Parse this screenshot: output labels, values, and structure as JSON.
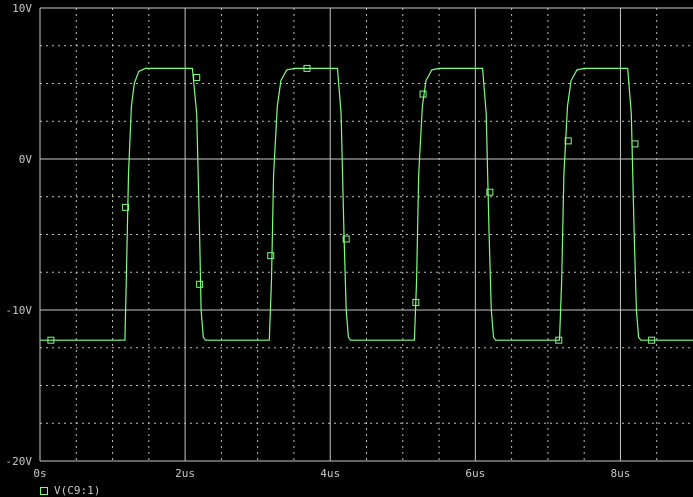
{
  "colors": {
    "background": "#000000",
    "axis": "#c8c8c8",
    "grid_major": "#c8c8c8",
    "grid_minor": "#bdbdbd",
    "trace": "#7dff7d"
  },
  "chart_data": {
    "type": "line",
    "title": "",
    "xlabel": "",
    "ylabel": "",
    "xlim": [
      0,
      9.0
    ],
    "ylim": [
      -20,
      10
    ],
    "x_unit": "us",
    "y_unit": "V",
    "x_ticks": [
      {
        "value": 0,
        "label": "0s"
      },
      {
        "value": 2,
        "label": "2us"
      },
      {
        "value": 4,
        "label": "4us"
      },
      {
        "value": 6,
        "label": "6us"
      },
      {
        "value": 8,
        "label": "8us"
      }
    ],
    "y_ticks": [
      {
        "value": 10,
        "label": "10V"
      },
      {
        "value": 0,
        "label": "0V"
      },
      {
        "value": -10,
        "label": "-10V"
      },
      {
        "value": -20,
        "label": "-20V"
      }
    ],
    "grid": true,
    "legend_position": "bottom-left",
    "series": [
      {
        "name": "V(C9:1)",
        "x": [
          0.0,
          1.17,
          1.19,
          1.22,
          1.26,
          1.3,
          1.36,
          1.45,
          1.55,
          2.1,
          2.16,
          2.2,
          2.22,
          2.25,
          2.28,
          3.16,
          3.19,
          3.22,
          3.27,
          3.32,
          3.4,
          3.5,
          4.1,
          4.15,
          4.19,
          4.22,
          4.25,
          4.28,
          5.16,
          5.19,
          5.22,
          5.27,
          5.32,
          5.4,
          5.5,
          6.1,
          6.15,
          6.19,
          6.22,
          6.25,
          6.28,
          7.16,
          7.19,
          7.22,
          7.27,
          7.32,
          7.4,
          7.5,
          8.1,
          8.15,
          8.19,
          8.22,
          8.25,
          8.28,
          9.0
        ],
        "y": [
          -12.0,
          -12.0,
          -8.0,
          -1.0,
          3.5,
          5.0,
          5.8,
          6.0,
          6.0,
          6.0,
          3.0,
          -5.0,
          -10.0,
          -11.8,
          -12.0,
          -12.0,
          -8.0,
          -1.0,
          3.5,
          5.2,
          5.9,
          6.0,
          6.0,
          3.0,
          -5.0,
          -10.0,
          -11.8,
          -12.0,
          -12.0,
          -8.0,
          -1.0,
          3.5,
          5.2,
          5.9,
          6.0,
          6.0,
          3.0,
          -5.0,
          -10.0,
          -11.8,
          -12.0,
          -12.0,
          -8.0,
          -1.0,
          3.5,
          5.2,
          5.9,
          6.0,
          6.0,
          3.0,
          -5.0,
          -10.0,
          -11.8,
          -12.0,
          -12.0
        ],
        "markers": [
          [
            0.15,
            -12.0
          ],
          [
            1.18,
            -3.2
          ],
          [
            2.16,
            5.4
          ],
          [
            2.2,
            -8.3
          ],
          [
            3.18,
            -6.4
          ],
          [
            3.68,
            6.0
          ],
          [
            4.22,
            -5.3
          ],
          [
            5.18,
            -9.5
          ],
          [
            5.28,
            4.3
          ],
          [
            6.2,
            -2.2
          ],
          [
            7.15,
            -12.0
          ],
          [
            7.28,
            1.2
          ],
          [
            8.2,
            1.0
          ],
          [
            8.43,
            -12.0
          ]
        ]
      }
    ]
  }
}
